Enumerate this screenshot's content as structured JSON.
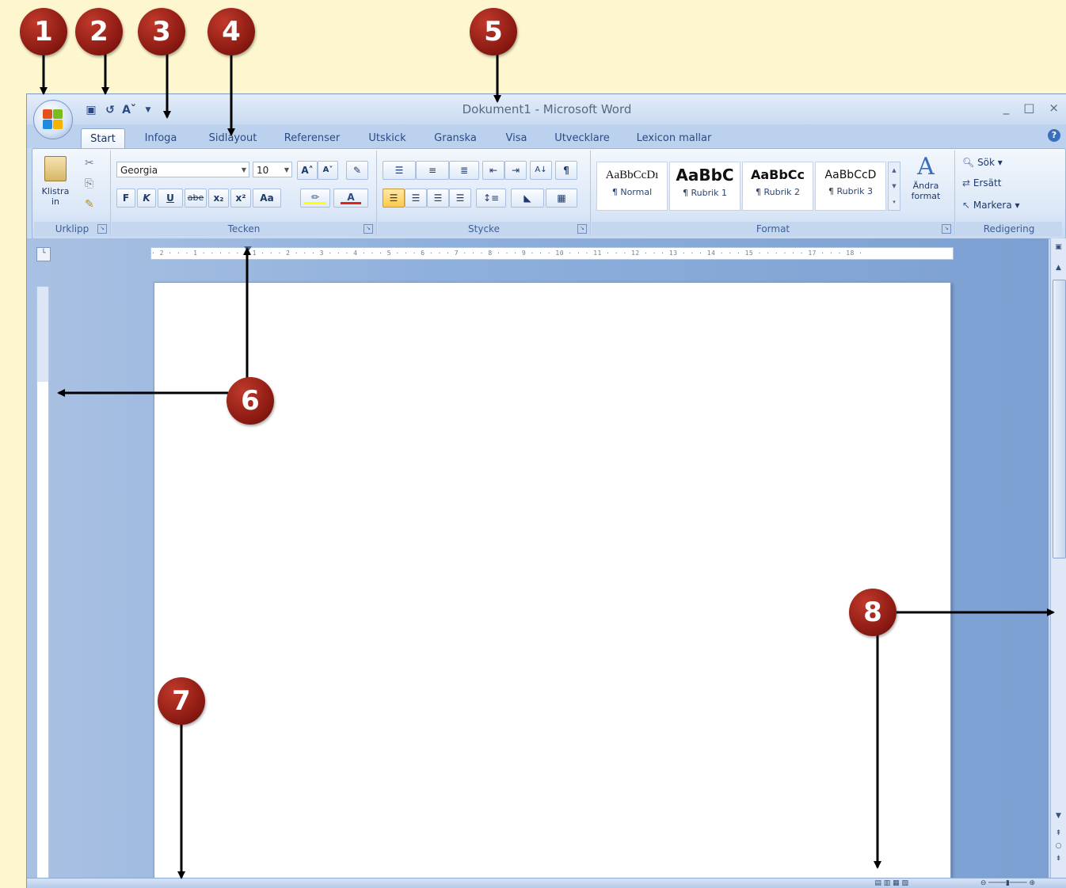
{
  "callouts": [
    "1",
    "2",
    "3",
    "4",
    "5",
    "6",
    "7",
    "8"
  ],
  "window": {
    "title": "Dokument1 - Microsoft Word",
    "controls": [
      "_",
      "□",
      "×"
    ]
  },
  "tabs": [
    "Start",
    "Infoga",
    "Sidlayout",
    "Referenser",
    "Utskick",
    "Granska",
    "Visa",
    "Utvecklare",
    "Lexicon mallar"
  ],
  "ribbon": {
    "clipboard": {
      "label": "Urklipp",
      "paste_line1": "Klistra",
      "paste_line2": "in"
    },
    "font": {
      "label": "Tecken",
      "font_name": "Georgia",
      "font_size": "10",
      "buttons": [
        "F",
        "K",
        "U",
        "abe",
        "x₂",
        "x²",
        "Aa"
      ]
    },
    "paragraph": {
      "label": "Stycke"
    },
    "styles": {
      "label": "Format",
      "items": [
        {
          "sample": "AaBbCcDı",
          "name": "¶ Normal"
        },
        {
          "sample": "AaBbC",
          "name": "¶ Rubrik 1"
        },
        {
          "sample": "AaBbCc",
          "name": "¶ Rubrik 2"
        },
        {
          "sample": "AaBbCcD",
          "name": "¶ Rubrik 3"
        }
      ],
      "change_line1": "Ändra",
      "change_line2": "format"
    },
    "editing": {
      "label": "Redigering",
      "find": "Sök",
      "replace": "Ersätt",
      "select": "Markera"
    }
  },
  "ruler": {
    "horizontal": "· 2 · · · 1 · · · · · · 1 · · · 2 · · · 3 · · · 4 · · · 5 · · · 6 · · · 7 · · · 8 · · · 9 · · · 10 · · · 11 · · · 12 · · · 13 · · · 14 · · · 15 · · · · · · 17 · · · 18 ·"
  },
  "colors": {
    "callout": "#8b1a12",
    "background": "#fdf6cf",
    "ribbon_text": "#274c86"
  }
}
